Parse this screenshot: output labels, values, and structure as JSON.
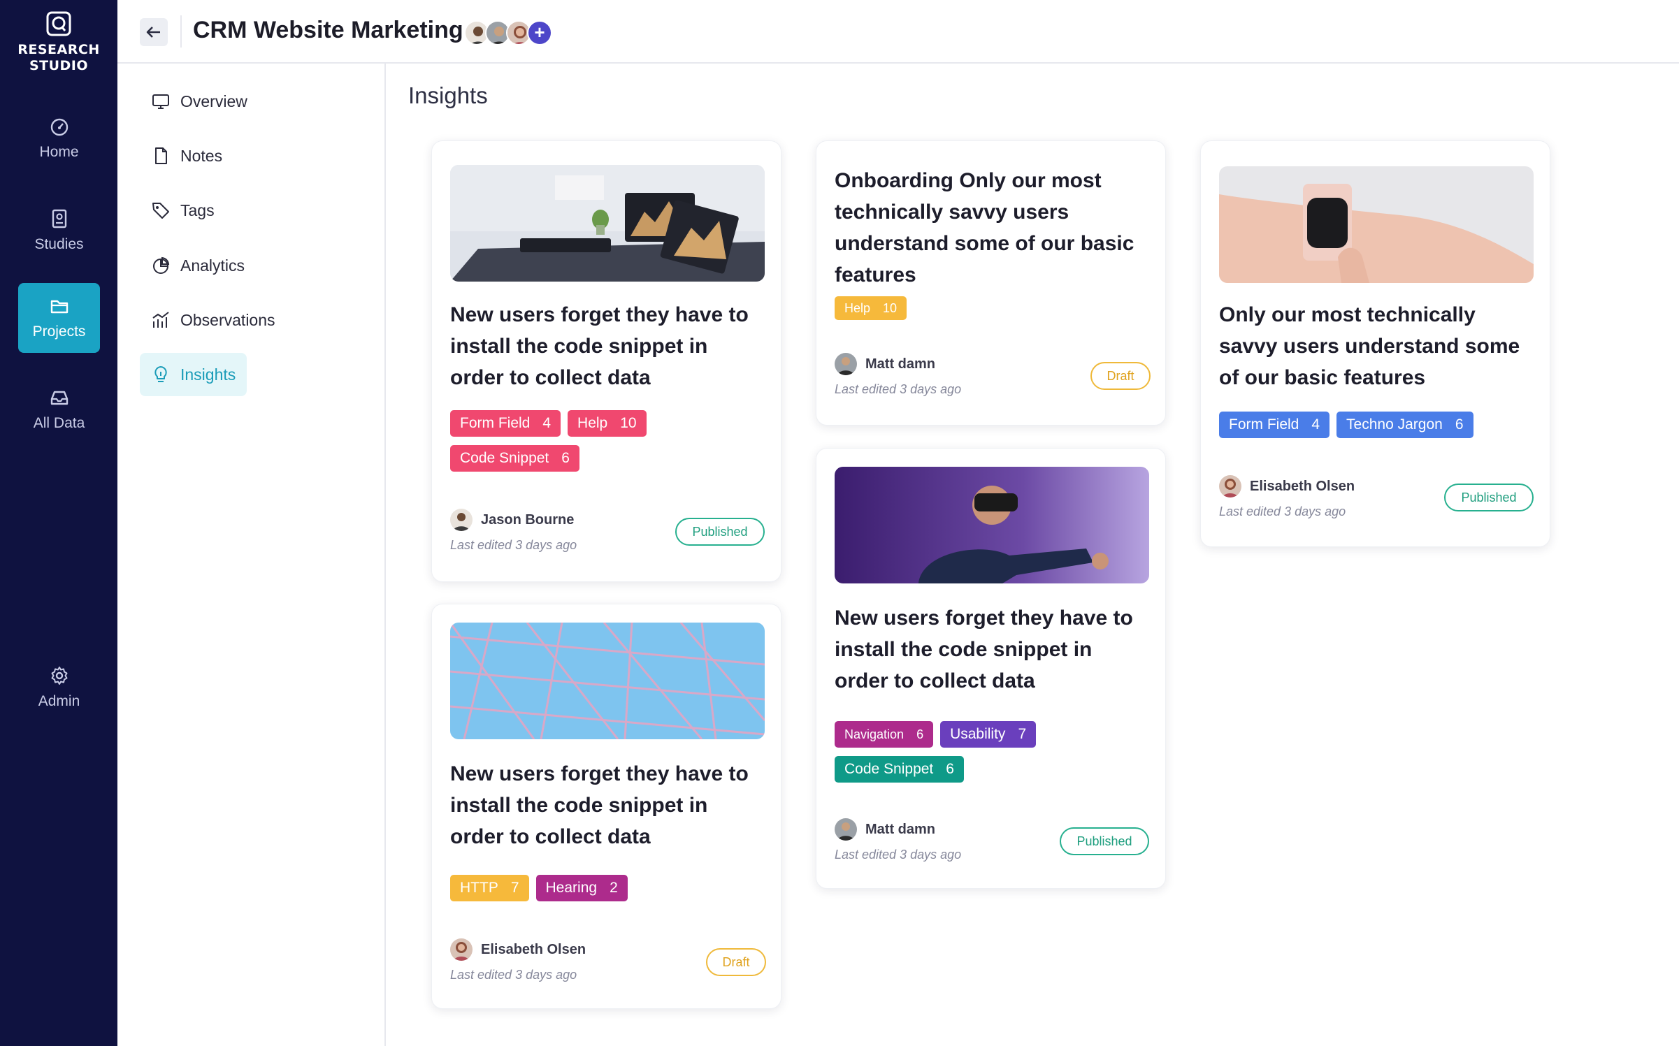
{
  "app": {
    "logo_line1": "RESEARCH",
    "logo_line2": "STUDIO"
  },
  "rail": [
    {
      "label": "Home",
      "icon": "dashboard-gauge-icon"
    },
    {
      "label": "Studies",
      "icon": "book-icon"
    },
    {
      "label": "Projects",
      "icon": "folder-icon",
      "active": true
    },
    {
      "label": "All Data",
      "icon": "inbox-tray-icon"
    },
    {
      "label": "Admin",
      "icon": "gear-icon"
    }
  ],
  "header": {
    "title": "CRM Website Marketing",
    "back_icon": "arrow-left-icon",
    "add_member_label": "+"
  },
  "subnav": [
    {
      "label": "Overview",
      "icon": "monitor-icon"
    },
    {
      "label": "Notes",
      "icon": "document-icon"
    },
    {
      "label": "Tags",
      "icon": "tag-icon"
    },
    {
      "label": "Analytics",
      "icon": "pie-chart-icon"
    },
    {
      "label": "Observations",
      "icon": "bar-trend-chart-icon"
    },
    {
      "label": "Insights",
      "icon": "lightbulb-icon",
      "active": true
    }
  ],
  "main": {
    "title": "Insights",
    "cards": [
      {
        "title": "New users forget they have to install the code snippet in order to collect data",
        "image": "desk-with-laptops",
        "tags": [
          {
            "label": "Form Field",
            "count": "4",
            "color": "#f0486f"
          },
          {
            "label": "Help",
            "count": "10",
            "color": "#f0486f"
          },
          {
            "label": "Code Snippet",
            "count": "6",
            "color": "#f0486f"
          }
        ],
        "author": "Jason Bourne",
        "edited": "Last edited 3 days ago",
        "status": "Published"
      },
      {
        "title": "New users forget they have to install the code snippet in order to collect data",
        "image": "net-against-blue-sky",
        "tags": [
          {
            "label": "HTTP",
            "count": "7",
            "color": "#f6b93b"
          },
          {
            "label": "Hearing",
            "count": "2",
            "color": "#ad2b8c"
          }
        ],
        "author": "Elisabeth Olsen",
        "edited": "Last edited 3 days ago",
        "status": "Draft"
      },
      {
        "title": "Onboarding Only our most technically savvy users understand some of our basic features",
        "tags": [
          {
            "label": "Help",
            "count": "10",
            "color": "#f6b93b"
          }
        ],
        "author": "Matt damn",
        "edited": "Last edited 3 days ago",
        "status": "Draft"
      },
      {
        "title": "New users forget they have to install the code snippet in order to collect data",
        "image": "man-with-vr-headset",
        "tags": [
          {
            "label": "Navigation",
            "count": "6",
            "color": "#ad2b8c"
          },
          {
            "label": "Usability",
            "count": "7",
            "color": "#6a3fbd"
          },
          {
            "label": "Code Snippet",
            "count": "6",
            "color": "#0f9a88"
          }
        ],
        "author": "Matt damn",
        "edited": "Last edited 3 days ago",
        "status": "Published"
      },
      {
        "title": "Only our most technically savvy users understand some of our basic features",
        "image": "smartwatch-on-wrist",
        "tags": [
          {
            "label": "Form Field",
            "count": "4",
            "color": "#4a7de8"
          },
          {
            "label": "Techno Jargon",
            "count": "6",
            "color": "#4a7de8"
          }
        ],
        "author": "Elisabeth Olsen",
        "edited": "Last edited 3 days ago",
        "status": "Published"
      }
    ]
  }
}
